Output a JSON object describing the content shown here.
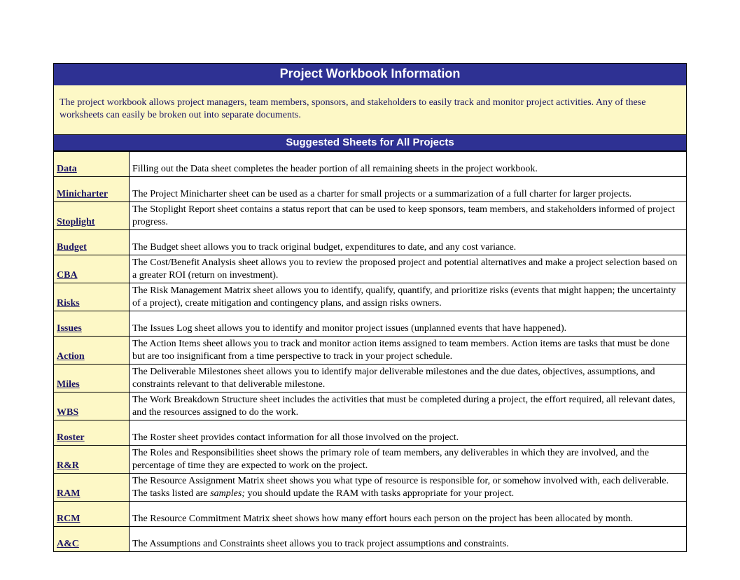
{
  "title": "Project Workbook Information",
  "intro": "The project workbook allows project managers, team members, sponsors, and stakeholders to easily track and monitor project activities. Any of these worksheets can easily be broken out into separate documents.",
  "section_title": "Suggested Sheets for All Projects",
  "rows": [
    {
      "name": "Data",
      "desc": "Filling out the Data sheet completes the header portion of all remaining sheets in the project workbook."
    },
    {
      "name": "Minicharter",
      "desc": "The Project Minicharter sheet can be used as a charter for small projects or a summarization of a full charter for larger projects."
    },
    {
      "name": "Stoplight",
      "desc": "The Stoplight Report sheet contains a status report that can be used to keep sponsors, team members, and stakeholders informed of project progress."
    },
    {
      "name": "Budget",
      "desc": "The Budget sheet allows you to track original budget, expenditures to date, and any cost variance."
    },
    {
      "name": "CBA",
      "desc": "The Cost/Benefit Analysis sheet allows you to review the proposed project and potential alternatives and make a project selection based on a greater ROI (return on investment)."
    },
    {
      "name": "Risks",
      "desc": "The Risk Management Matrix sheet allows you to identify, qualify, quantify, and prioritize risks (events that might happen; the uncertainty of a project), create mitigation and contingency plans, and assign risks owners."
    },
    {
      "name": "Issues",
      "desc": "The Issues Log sheet allows you to identify and monitor project issues (unplanned events that have happened)."
    },
    {
      "name": "Action",
      "desc": "The Action Items sheet allows you to track and monitor action items assigned to team members. Action items are tasks that must be done but are too insignificant from a time perspective to track in your project schedule."
    },
    {
      "name": "Miles",
      "desc": "The Deliverable Milestones sheet allows you to identify major deliverable milestones and the due dates, objectives, assumptions, and constraints relevant to that deliverable milestone."
    },
    {
      "name": "WBS",
      "desc": "The Work Breakdown Structure sheet includes the activities that must be completed during a project, the effort required, all relevant dates, and the resources assigned to do the work."
    },
    {
      "name": "Roster",
      "desc": "The Roster sheet provides contact information for all those involved on the project."
    },
    {
      "name": "R&R",
      "desc": "The Roles and Responsibilities sheet shows the primary role of team members, any deliverables in which they are involved, and the percentage of time they are expected to work on the project."
    },
    {
      "name": "RAM",
      "desc_html": "The Resource Assignment Matrix sheet shows you what type of resource is responsible for, or somehow involved with, each deliverable. The tasks listed are <em>samples;</em> you should update the RAM with tasks appropriate for your project."
    },
    {
      "name": "RCM",
      "desc": "The Resource Commitment Matrix sheet shows how many effort hours each person on the project has been allocated by month."
    },
    {
      "name": "A&C",
      "desc": "The Assumptions and Constraints sheet allows you to track project assumptions and constraints."
    }
  ]
}
